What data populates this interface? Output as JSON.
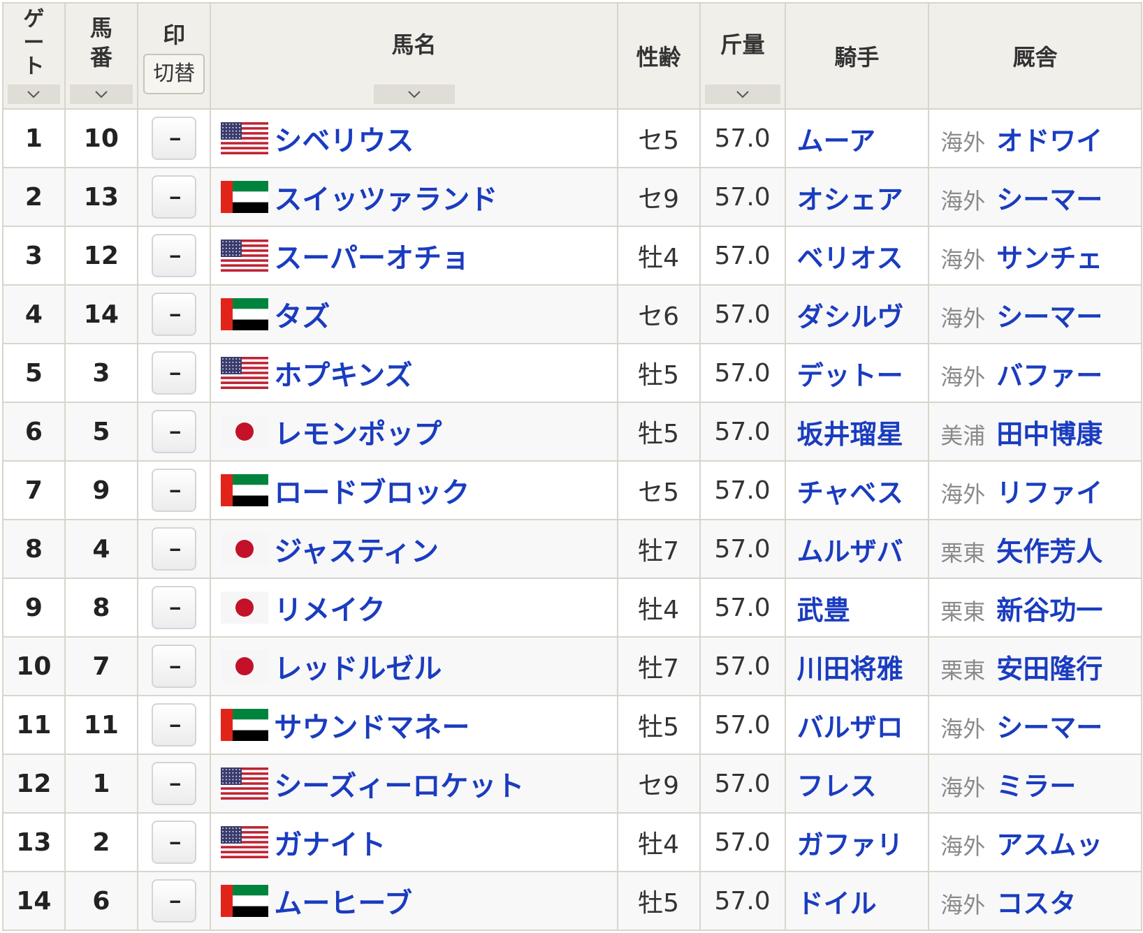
{
  "header": {
    "gate_label": [
      "ゲ",
      "ー",
      "ト"
    ],
    "number_label": [
      "馬",
      "番"
    ],
    "mark_label": "印",
    "mark_toggle": "切替",
    "name_label": "馬名",
    "sexage_label": "性齢",
    "weight_label": "斤量",
    "jockey_label": "騎手",
    "trainer_label": "厩舎"
  },
  "mark_default": "--",
  "colors": {
    "link": "#1a3cbf",
    "region": "#8a8a8a",
    "border": "#d9d5cc",
    "header_bg": "#f1efea"
  },
  "rows": [
    {
      "gate": "1",
      "num": "10",
      "flag": "usa",
      "name": "シベリウス",
      "sexage": "セ5",
      "weight": "57.0",
      "jockey": "ムーア",
      "region": "海外",
      "trainer": "オドワイ"
    },
    {
      "gate": "2",
      "num": "13",
      "flag": "uae",
      "name": "スイッツァランド",
      "sexage": "セ9",
      "weight": "57.0",
      "jockey": "オシェア",
      "region": "海外",
      "trainer": "シーマー"
    },
    {
      "gate": "3",
      "num": "12",
      "flag": "usa",
      "name": "スーパーオチョ",
      "sexage": "牡4",
      "weight": "57.0",
      "jockey": "ベリオス",
      "region": "海外",
      "trainer": "サンチェ"
    },
    {
      "gate": "4",
      "num": "14",
      "flag": "uae",
      "name": "タズ",
      "sexage": "セ6",
      "weight": "57.0",
      "jockey": "ダシルヴ",
      "region": "海外",
      "trainer": "シーマー"
    },
    {
      "gate": "5",
      "num": "3",
      "flag": "usa",
      "name": "ホプキンズ",
      "sexage": "牡5",
      "weight": "57.0",
      "jockey": "デットー",
      "region": "海外",
      "trainer": "バファー"
    },
    {
      "gate": "6",
      "num": "5",
      "flag": "japan",
      "name": "レモンポップ",
      "sexage": "牡5",
      "weight": "57.0",
      "jockey": "坂井瑠星",
      "region": "美浦",
      "trainer": "田中博康"
    },
    {
      "gate": "7",
      "num": "9",
      "flag": "uae",
      "name": "ロードブロック",
      "sexage": "セ5",
      "weight": "57.0",
      "jockey": "チャベス",
      "region": "海外",
      "trainer": "リファイ"
    },
    {
      "gate": "8",
      "num": "4",
      "flag": "japan",
      "name": "ジャスティン",
      "sexage": "牡7",
      "weight": "57.0",
      "jockey": "ムルザバ",
      "region": "栗東",
      "trainer": "矢作芳人"
    },
    {
      "gate": "9",
      "num": "8",
      "flag": "japan",
      "name": "リメイク",
      "sexage": "牡4",
      "weight": "57.0",
      "jockey": "武豊",
      "region": "栗東",
      "trainer": "新谷功一"
    },
    {
      "gate": "10",
      "num": "7",
      "flag": "japan",
      "name": "レッドルゼル",
      "sexage": "牡7",
      "weight": "57.0",
      "jockey": "川田将雅",
      "region": "栗東",
      "trainer": "安田隆行"
    },
    {
      "gate": "11",
      "num": "11",
      "flag": "uae",
      "name": "サウンドマネー",
      "sexage": "牡5",
      "weight": "57.0",
      "jockey": "バルザロ",
      "region": "海外",
      "trainer": "シーマー"
    },
    {
      "gate": "12",
      "num": "1",
      "flag": "usa",
      "name": "シーズィーロケット",
      "sexage": "セ9",
      "weight": "57.0",
      "jockey": "フレス",
      "region": "海外",
      "trainer": "ミラー"
    },
    {
      "gate": "13",
      "num": "2",
      "flag": "usa",
      "name": "ガナイト",
      "sexage": "牡4",
      "weight": "57.0",
      "jockey": "ガファリ",
      "region": "海外",
      "trainer": "アスムッ"
    },
    {
      "gate": "14",
      "num": "6",
      "flag": "uae",
      "name": "ムーヒーブ",
      "sexage": "牡5",
      "weight": "57.0",
      "jockey": "ドイル",
      "region": "海外",
      "trainer": "コスタ"
    }
  ]
}
